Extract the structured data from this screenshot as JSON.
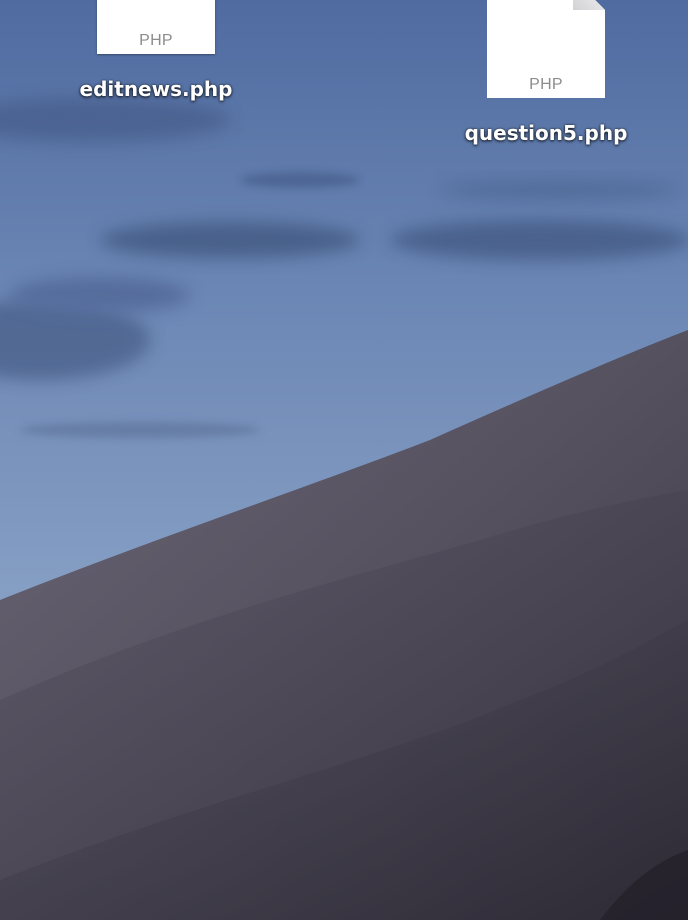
{
  "desktop": {
    "wallpaper": {
      "name": "desert-dusk-wallpaper",
      "sky_top": "#4f6c9e",
      "sky_bottom": "#8ea4c6",
      "dune_light": "#5f5c6c",
      "dune_dark": "#2e2b36"
    },
    "files": [
      {
        "name": "editnews.php",
        "type_label": "PHP",
        "icon": "php-document-icon"
      },
      {
        "name": "question5.php",
        "type_label": "PHP",
        "icon": "php-document-icon"
      }
    ]
  }
}
